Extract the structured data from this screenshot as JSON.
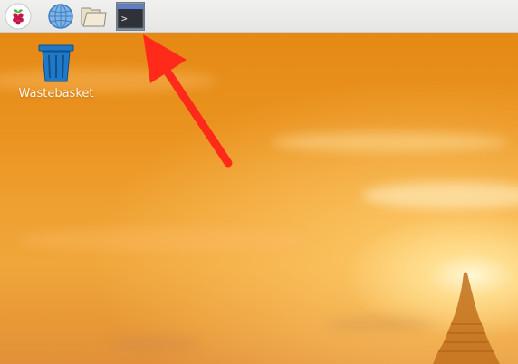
{
  "taskbar": {
    "launchers": [
      {
        "name": "menu",
        "icon": "raspberry-pi-icon"
      },
      {
        "name": "web-browser",
        "icon": "globe-icon"
      },
      {
        "name": "file-manager",
        "icon": "folder-icon"
      },
      {
        "name": "terminal",
        "icon": "terminal-icon",
        "active": true
      }
    ]
  },
  "terminal_prompt": ">_",
  "desktop": {
    "icons": [
      {
        "label": "Wastebasket",
        "icon": "trash-icon"
      }
    ]
  },
  "colors": {
    "annotation_arrow": "#ff2a1a",
    "active_launcher": "#8a95a6",
    "trash_blue": "#1f79c9"
  }
}
